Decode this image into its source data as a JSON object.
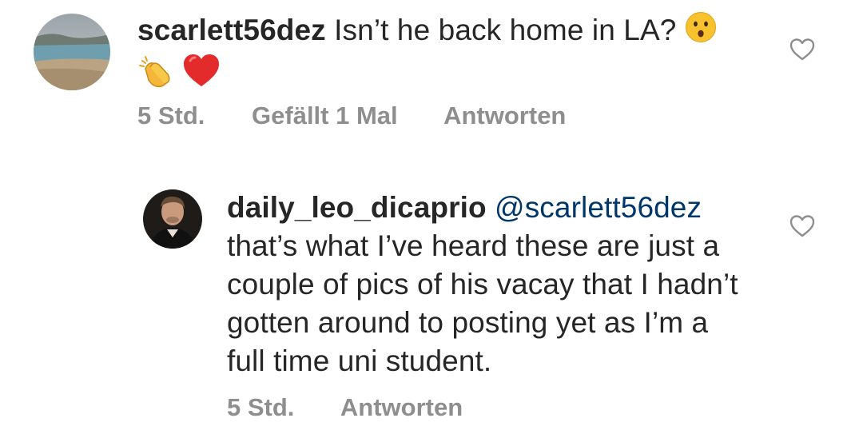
{
  "comments": [
    {
      "username": "scarlett56dez",
      "text": "Isn’t he back home in LA?",
      "emojis": [
        "hushed-face",
        "clapping-hands",
        "red-heart"
      ],
      "time": "5 Std.",
      "likes": "Gefällt 1 Mal",
      "reply": "Antworten"
    },
    {
      "username": "daily_leo_dicaprio",
      "mention": "@scarlett56dez",
      "text": "that’s what I’ve heard these are just a couple of pics of his vacay that I hadn’t gotten around to posting yet as I’m a full time uni student.",
      "time": "5 Std.",
      "reply": "Antworten"
    }
  ],
  "colors": {
    "text": "#262626",
    "meta": "#8e8e8e",
    "mention": "#00376b"
  }
}
